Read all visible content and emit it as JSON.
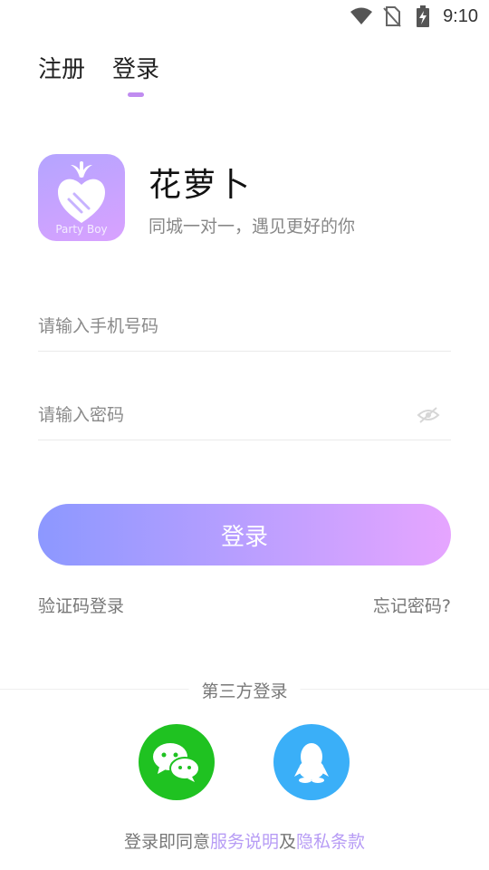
{
  "status_bar": {
    "time": "9:10",
    "icons": [
      "wifi-icon",
      "no-sim-icon",
      "battery-charging-icon"
    ]
  },
  "tabs": [
    {
      "label": "注册",
      "active": false
    },
    {
      "label": "登录",
      "active": true
    }
  ],
  "brand": {
    "logo_text": "Party Boy",
    "name": "花萝卜",
    "slogan": "同城一对一，遇见更好的你"
  },
  "form": {
    "phone_placeholder": "请输入手机号码",
    "password_placeholder": "请输入密码",
    "submit_label": "登录"
  },
  "links": {
    "sms_login": "验证码登录",
    "forgot_password": "忘记密码?"
  },
  "third_party": {
    "label": "第三方登录",
    "providers": [
      "wechat-icon",
      "qq-icon"
    ]
  },
  "agreement": {
    "prefix": "登录即同意",
    "terms": "服务说明",
    "and": "及",
    "privacy": "隐私条款"
  },
  "colors": {
    "accent": "#c08cf0",
    "button_start": "#8c98ff",
    "button_end": "#e6a5ff",
    "wechat": "#1fc221",
    "qq": "#3aaff8",
    "link_highlight": "#b79cf5"
  }
}
